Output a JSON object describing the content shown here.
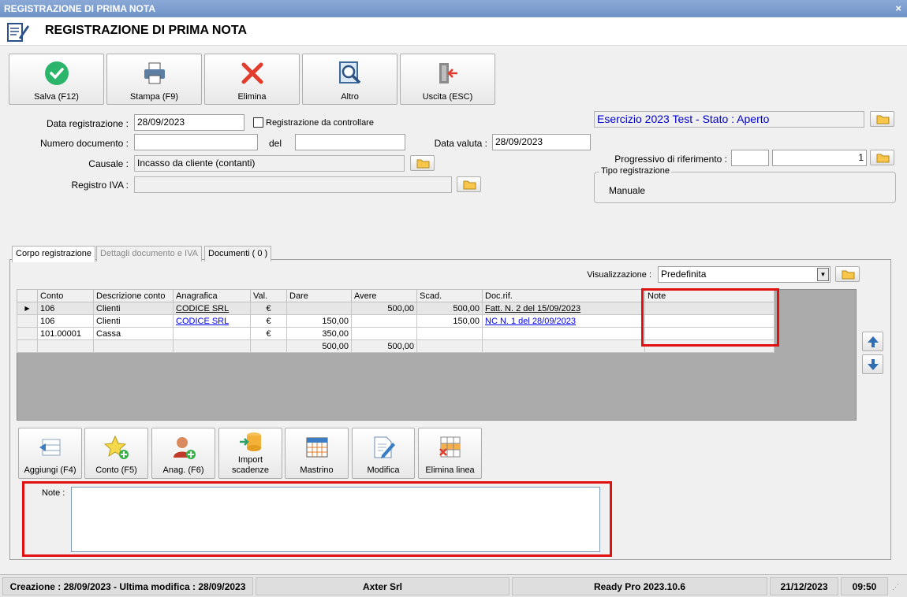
{
  "window": {
    "title": "REGISTRAZIONE DI PRIMA NOTA",
    "caption": "REGISTRAZIONE DI PRIMA NOTA",
    "close": "×"
  },
  "toolbar": {
    "save": "Salva (F12)",
    "print": "Stampa (F9)",
    "delete": "Elimina",
    "other": "Altro",
    "exit": "Uscita (ESC)"
  },
  "form": {
    "data_registrazione_label": "Data registrazione :",
    "data_registrazione": "28/09/2023",
    "da_controllare_label": "Registrazione da controllare",
    "numero_documento_label": "Numero documento :",
    "numero_documento": "",
    "del_label": "del",
    "del_value": "",
    "data_valuta_label": "Data valuta :",
    "data_valuta": "28/09/2023",
    "causale_label": "Causale :",
    "causale": "Incasso da cliente (contanti)",
    "registro_iva_label": "Registro IVA :",
    "registro_iva": "",
    "esercizio": "Esercizio 2023 Test - Stato : Aperto",
    "progressivo_label": "Progressivo di riferimento :",
    "progressivo_a": "",
    "progressivo_b": "1",
    "tipo_registrazione_label": "Tipo registrazione",
    "tipo_registrazione": "Manuale"
  },
  "tabs": [
    {
      "label": "Corpo registrazione"
    },
    {
      "label": "Dettagli documento e IVA"
    },
    {
      "label": "Documenti ( 0 )"
    }
  ],
  "view": {
    "label": "Visualizzazione :",
    "value": "Predefinita"
  },
  "grid": {
    "columns": [
      "Conto",
      "Descrizione conto",
      "Anagrafica",
      "Val.",
      "Dare",
      "Avere",
      "Scad.",
      "Doc.rif.",
      "Note"
    ],
    "rows": [
      {
        "marker": "▶",
        "conto": "106",
        "descr": "Clienti",
        "anagrafica": "CODICE SRL",
        "val": "€",
        "dare": "",
        "avere": "500,00",
        "scad": "500,00",
        "docrif": "Fatt. N. 2 del 15/09/2023",
        "note": ""
      },
      {
        "marker": "",
        "conto": "106",
        "descr": "Clienti",
        "anagrafica": "CODICE SRL",
        "val": "€",
        "dare": "150,00",
        "avere": "",
        "scad": "150,00",
        "docrif": "NC N. 1 del 28/09/2023",
        "note": ""
      },
      {
        "marker": "",
        "conto": "101.00001",
        "descr": "Cassa",
        "anagrafica": "",
        "val": "€",
        "dare": "350,00",
        "avere": "",
        "scad": "",
        "docrif": "",
        "note": ""
      }
    ],
    "totals": {
      "dare": "500,00",
      "avere": "500,00"
    }
  },
  "actions": {
    "add": "Aggiungi (F4)",
    "account": "Conto (F5)",
    "registry": "Anag. (F6)",
    "import_line1": "Import",
    "import_line2": "scadenze",
    "ledger": "Mastrino",
    "edit": "Modifica",
    "delete_line": "Elimina linea"
  },
  "notes": {
    "label": "Note :",
    "value": ""
  },
  "status": {
    "created": "Creazione : 28/09/2023 - Ultima modifica : 28/09/2023",
    "company": "Axter Srl",
    "product": "Ready Pro 2023.10.6",
    "date": "21/12/2023",
    "time": "09:50"
  },
  "colors": {
    "accent_red": "#e01010",
    "link_blue": "#0000ee",
    "title_blue": "#6f93c8",
    "esercizio_blue": "#0000cc"
  }
}
